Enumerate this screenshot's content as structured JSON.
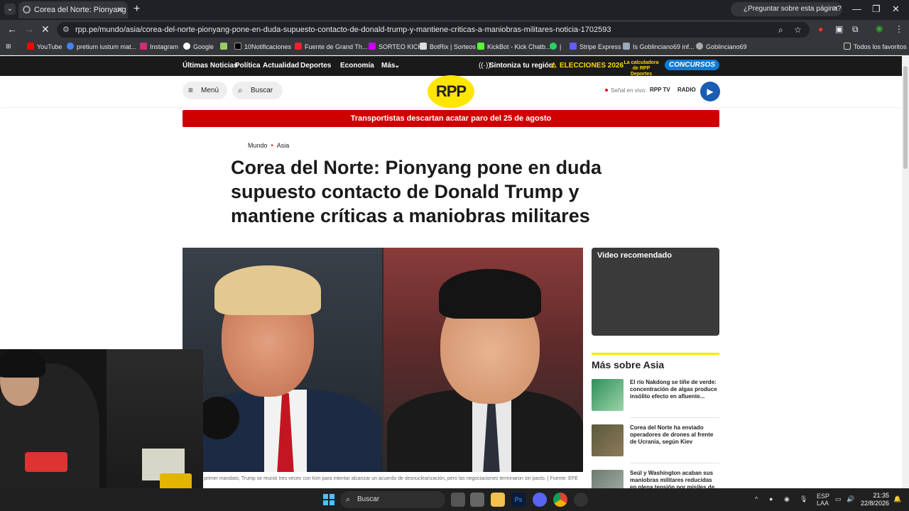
{
  "browser": {
    "tab_title": "Corea del Norte: Pionyang pone en duda...",
    "ask_panel": "¿Preguntar sobre esta página?",
    "url": "rpp.pe/mundo/asia/corea-del-norte-pionyang-pone-en-duda-supuesto-contacto-de-donald-trump-y-mantiene-criticas-a-maniobras-militares-noticia-1702593",
    "bookmarks": [
      "YouTube",
      "pretium iustum mat...",
      "Instagram",
      "Google",
      "10Notificaciones",
      "Fuente de Grand Th...",
      "SORTEO KICK",
      "BotRix | Sorteos",
      "KickBot - Kick Chatb...",
      "|",
      "Stripe Express",
      "Is Goblinciano69 inf...",
      "Goblinciano69"
    ],
    "all_favorites": "Todos los favoritos"
  },
  "site": {
    "topnav": [
      "Últimas Noticias",
      "Política",
      "Actualidad",
      "Deportes",
      "Economía",
      "Más"
    ],
    "sintoniza": "Sintoniza tu región",
    "elecciones": "ELECCIONES 2026",
    "calculadora": "La calculadora de RPP Deportes",
    "concursos": "CONCURSOS",
    "menu": "Menú",
    "buscar": "Buscar",
    "logo": "RPP",
    "senal": "Señal en vivo:",
    "rpptv": "RPP TV",
    "radio": "RADIO",
    "alert": "Transportistas descartan acatar paro del 25 de agosto"
  },
  "article": {
    "crumb1": "Mundo",
    "crumb2": "Asia",
    "headline": "Corea del Norte: Pionyang pone en duda supuesto contacto de Donald Trump y mantiene críticas a maniobras militares",
    "caption": "...nte su primer mandato, Trump se reunió tres veces con Kim para intentar alcanzar un acuerdo de desnuclearización, pero las negociaciones terminaron sin pacto. | Fuente: EFE"
  },
  "sidebar": {
    "video_label": "Video recomendado",
    "mas_title": "Más sobre Asia",
    "related": [
      "El río Nakdong se tiñe de verde: concentración de algas produce insólito efecto en afluente...",
      "Corea del Norte ha enviado operadores de drones al frente de Ucrania, según Kiev",
      "Seúl y Washington acaban sus maniobras militares reducidas en plena tensión por misiles de..."
    ]
  },
  "taskbar": {
    "search": "Buscar",
    "lang1": "ESP",
    "lang2": "LAA",
    "time": "21:35",
    "date": "22/8/2026"
  }
}
